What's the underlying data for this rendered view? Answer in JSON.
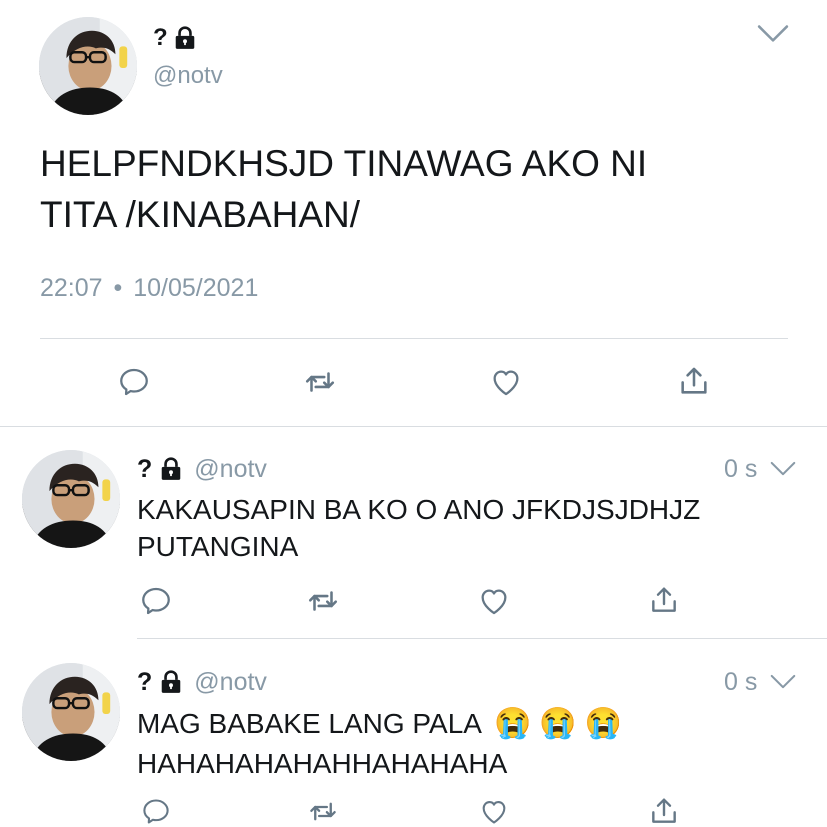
{
  "main_tweet": {
    "name": "?",
    "handle": "@notv",
    "text_line1": "HELPFNDKHSJD TINAWAG AKO NI",
    "text_line2": "TITA /KINABAHAN/",
    "time": "22:07",
    "separator": "•",
    "date": "10/05/2021"
  },
  "replies": [
    {
      "name": "?",
      "handle": "@notv",
      "time": "0 s",
      "text_line1": "KAKAUSAPIN BA KO O ANO JFKDJSJDHJZ",
      "text_line2": "PUTANGINA"
    },
    {
      "name": "?",
      "handle": "@notv",
      "time": "0 s",
      "text_line1": "MAG BABAKE LANG PALA",
      "emoji": [
        "😭",
        "😭",
        "😭"
      ],
      "text_line2": "HAHAHAHAHAHHAHAHAHA"
    }
  ],
  "icons": [
    "lock-icon",
    "chevron-down-icon",
    "reply-icon",
    "retweet-icon",
    "like-icon",
    "share-icon"
  ],
  "colors": {
    "text": "#14171a",
    "muted": "#8899a6",
    "icon": "#657786",
    "divider": "#d9dde1"
  }
}
